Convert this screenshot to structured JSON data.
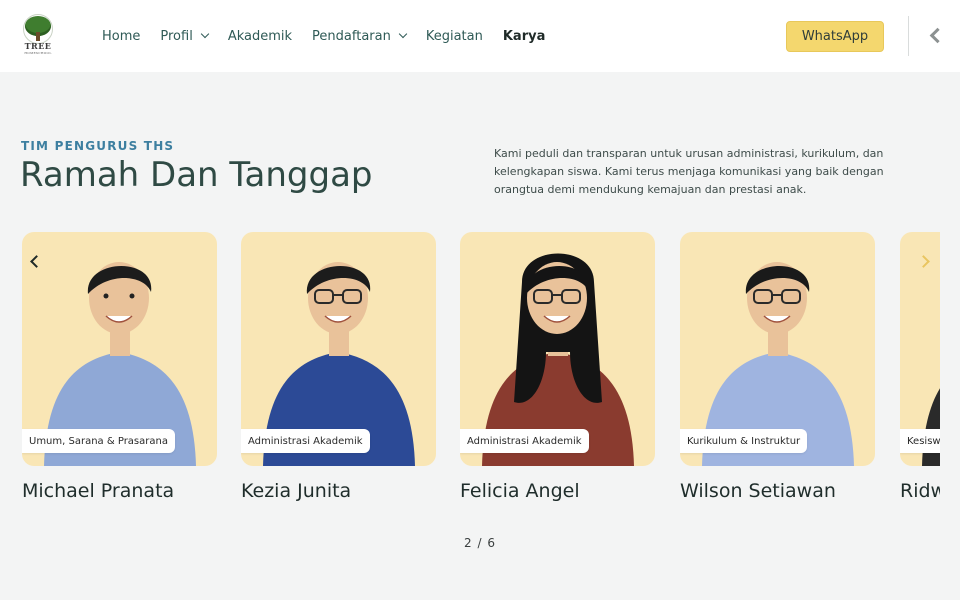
{
  "logo": {
    "name": "TREE",
    "subtitle": "HOMESCHOOL"
  },
  "nav": {
    "items": [
      {
        "label": "Home",
        "dropdown": false
      },
      {
        "label": "Profil",
        "dropdown": true
      },
      {
        "label": "Akademik",
        "dropdown": false
      },
      {
        "label": "Pendaftaran",
        "dropdown": true
      },
      {
        "label": "Kegiatan",
        "dropdown": false
      },
      {
        "label": "Karya",
        "dropdown": false,
        "active": true
      }
    ],
    "whatsapp_label": "WhatsApp"
  },
  "section": {
    "eyebrow": "TIM PENGURUS THS",
    "title": "Ramah Dan Tanggap",
    "description": "Kami peduli dan transparan untuk urusan administrasi, kurikulum, dan kelengkapan siswa. Kami terus menjaga komunikasi yang baik dengan orangtua demi mendukung kemajuan dan prestasi anak."
  },
  "team": {
    "members": [
      {
        "name": "Michael Pranata",
        "role": "Umum, Sarana & Prasarana",
        "shirt": "#8fa8d6",
        "hair": "#1c1c1c",
        "glasses": false,
        "long_hair": false
      },
      {
        "name": "Kezia Junita",
        "role": "Administrasi Akademik",
        "shirt": "#2c4a96",
        "hair": "#1c1c1c",
        "glasses": true,
        "long_hair": false
      },
      {
        "name": "Felicia Angel",
        "role": "Administrasi Akademik",
        "shirt": "#8a3b2f",
        "hair": "#141414",
        "glasses": true,
        "long_hair": true
      },
      {
        "name": "Wilson Setiawan",
        "role": "Kurikulum & Instruktur",
        "shirt": "#9fb4e0",
        "hair": "#1a1a1a",
        "glasses": true,
        "long_hair": false
      },
      {
        "name": "Ridwan",
        "role": "Kesiswaan",
        "shirt": "#2a2a2a",
        "hair": "#1a1a1a",
        "glasses": false,
        "long_hair": false
      }
    ]
  },
  "pager": {
    "current": "2",
    "total": "6",
    "text": "2 / 6"
  },
  "colors": {
    "accent": "#f4d76e",
    "card_bg": "#f9e6b5",
    "eyebrow": "#3d7fa0",
    "title": "#2f4a44"
  }
}
